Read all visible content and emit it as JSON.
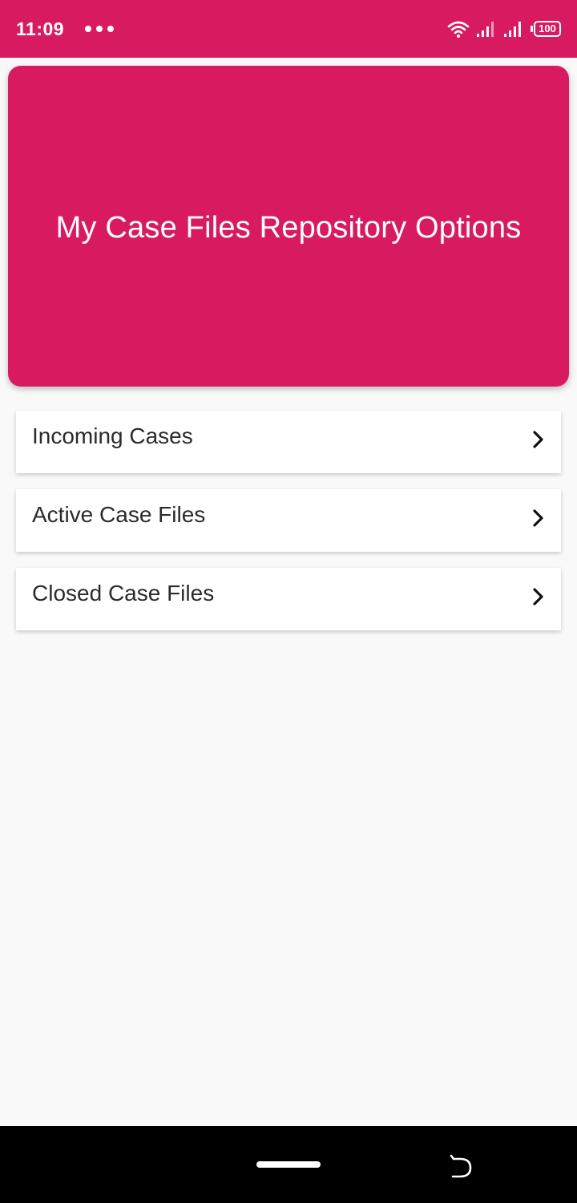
{
  "status_bar": {
    "time": "11:09",
    "battery": "100"
  },
  "header": {
    "title": "My Case Files Repository Options"
  },
  "options": [
    {
      "label": "Incoming Cases"
    },
    {
      "label": "Active Case Files"
    },
    {
      "label": "Closed Case Files"
    }
  ],
  "colors": {
    "accent": "#d81b60",
    "background": "#f9f9f9",
    "card": "#ffffff",
    "text": "#2b2b2b"
  },
  "icons": {
    "status": [
      "more-dots-icon",
      "wifi-icon",
      "signal-icon",
      "signal-icon",
      "battery-icon"
    ],
    "list": "chevron-right-icon",
    "nav": [
      "home-pill-icon",
      "back-gesture-icon"
    ]
  }
}
